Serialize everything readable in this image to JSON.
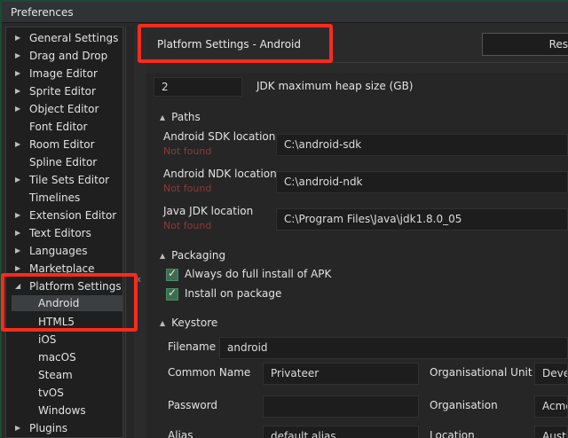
{
  "window": {
    "title": "Preferences"
  },
  "sidebar": {
    "items": [
      {
        "label": "General Settings",
        "expandable": true
      },
      {
        "label": "Drag and Drop",
        "expandable": true
      },
      {
        "label": "Image Editor",
        "expandable": true
      },
      {
        "label": "Sprite Editor",
        "expandable": true
      },
      {
        "label": "Object Editor",
        "expandable": true
      },
      {
        "label": "Font Editor",
        "expandable": false
      },
      {
        "label": "Room Editor",
        "expandable": true
      },
      {
        "label": "Spline Editor",
        "expandable": false
      },
      {
        "label": "Tile Sets Editor",
        "expandable": true
      },
      {
        "label": "Timelines",
        "expandable": false
      },
      {
        "label": "Extension Editor",
        "expandable": true
      },
      {
        "label": "Text Editors",
        "expandable": true
      },
      {
        "label": "Languages",
        "expandable": true
      },
      {
        "label": "Marketplace",
        "expandable": true
      },
      {
        "label": "Platform Settings",
        "expandable": true,
        "expanded": true
      },
      {
        "label": "Android",
        "child": true,
        "selected": true
      },
      {
        "label": "HTML5",
        "child": true
      },
      {
        "label": "iOS",
        "child": true
      },
      {
        "label": "macOS",
        "child": true
      },
      {
        "label": "Steam",
        "child": true
      },
      {
        "label": "tvOS",
        "child": true
      },
      {
        "label": "Windows",
        "child": true
      },
      {
        "label": "Plugins",
        "expandable": true
      }
    ]
  },
  "header": {
    "title": "Platform Settings - Android",
    "reset_label": "Res"
  },
  "jdk_heap": {
    "value": "2",
    "label": "JDK maximum heap size (GB)"
  },
  "paths": {
    "heading": "Paths",
    "rows": [
      {
        "label": "Android SDK location",
        "status": "Not found",
        "value": "C:\\android-sdk"
      },
      {
        "label": "Android NDK location",
        "status": "Not found",
        "value": "C:\\android-ndk"
      },
      {
        "label": "Java JDK location",
        "status": "Not found",
        "value": "C:\\Program Files\\Java\\jdk1.8.0_05"
      }
    ]
  },
  "packaging": {
    "heading": "Packaging",
    "options": [
      {
        "label": "Always do full install of APK",
        "checked": true
      },
      {
        "label": "Install on package",
        "checked": true
      }
    ]
  },
  "keystore": {
    "heading": "Keystore",
    "filename_label": "Filename",
    "filename_value": "android",
    "common_name_label": "Common Name",
    "common_name_value": "Privateer",
    "org_unit_label": "Organisational Unit",
    "org_unit_value": "Deve",
    "password_label": "Password",
    "password_value": "",
    "organisation_label": "Organisation",
    "organisation_value": "Acme",
    "alias_label": "Alias",
    "alias_value": "default alias",
    "location_label": "Location",
    "location_value": "Austi"
  },
  "colors": {
    "accent_checkbox": "#3a6e4f",
    "not_found": "#8c3a3a",
    "highlight": "#ff2a1a"
  }
}
